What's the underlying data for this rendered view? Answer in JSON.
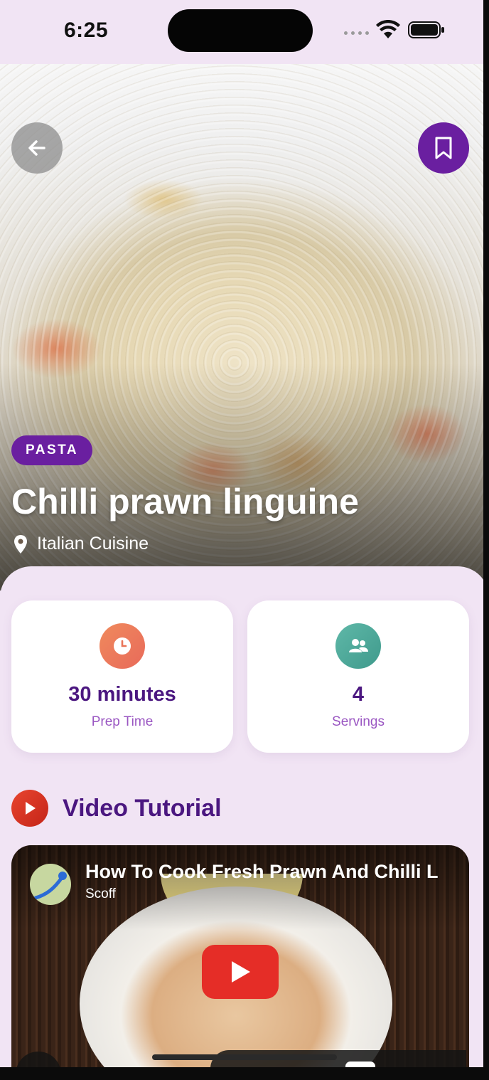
{
  "status_bar": {
    "time": "6:25"
  },
  "hero": {
    "category": "PASTA",
    "title": "Chilli prawn linguine",
    "location": "Italian Cuisine"
  },
  "stats": [
    {
      "icon": "clock-icon",
      "value": "30 minutes",
      "label": "Prep Time"
    },
    {
      "icon": "people-icon",
      "value": "4",
      "label": "Servings"
    }
  ],
  "video": {
    "section_title": "Video Tutorial",
    "name": "How To Cook Fresh Prawn And Chilli L",
    "channel": "Scoff"
  },
  "colors": {
    "accent": "#6a1fa0",
    "title_text": "#4b1780",
    "label_text": "#9a56c2",
    "background": "#f1e4f4",
    "youtube_red": "#e52d27"
  }
}
